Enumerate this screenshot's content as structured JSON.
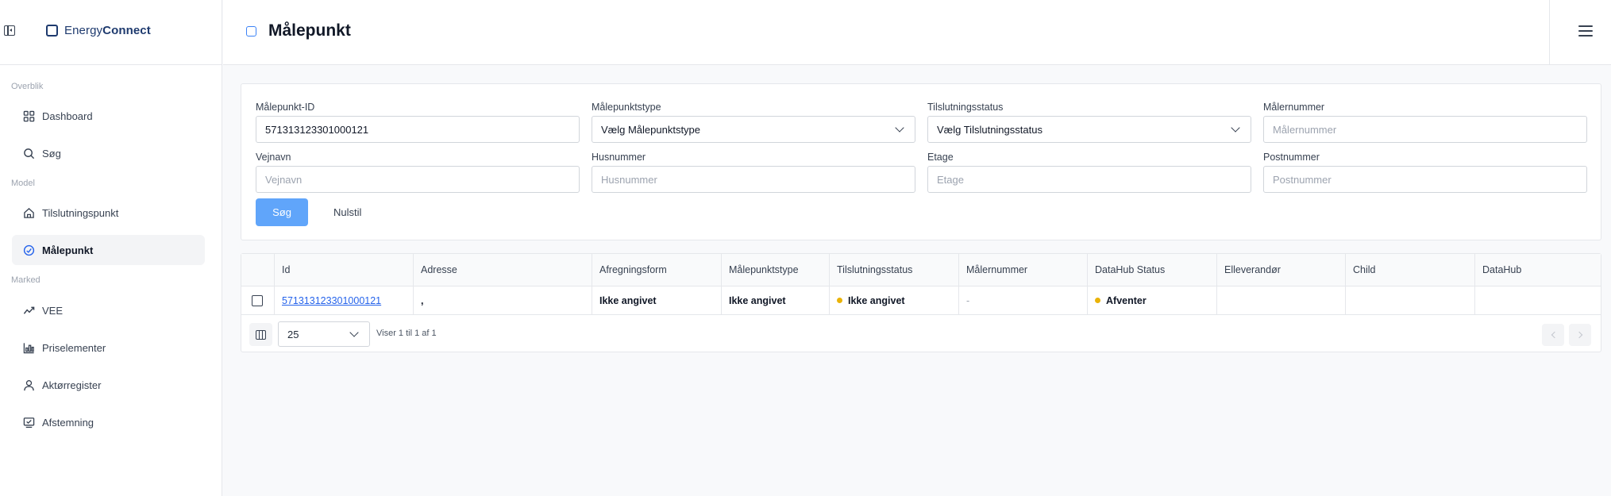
{
  "app": {
    "brand_regular": "Energy",
    "brand_bold": "Connect"
  },
  "sidebar": {
    "sections": [
      {
        "label": "Overblik"
      },
      {
        "label": "Model"
      },
      {
        "label": "Marked"
      }
    ],
    "items": [
      {
        "label": "Dashboard",
        "icon": "grid-icon"
      },
      {
        "label": "Søg",
        "icon": "search-icon"
      },
      {
        "label": "Tilslutningspunkt",
        "icon": "home-icon"
      },
      {
        "label": "Målepunkt",
        "icon": "gauge-icon",
        "active": true
      },
      {
        "label": "VEE",
        "icon": "activity-icon"
      },
      {
        "label": "Priselementer",
        "icon": "bar-chart-icon"
      },
      {
        "label": "Aktørregister",
        "icon": "user-icon"
      },
      {
        "label": "Afstemning",
        "icon": "check-screen-icon"
      }
    ]
  },
  "header": {
    "title": "Målepunkt"
  },
  "filters": {
    "malepunkt_id": {
      "label": "Målepunkt-ID",
      "value": "571313123301000121"
    },
    "malepunktstype": {
      "label": "Målepunktstype",
      "value": "Vælg Målepunktstype"
    },
    "tilslutningsstatus": {
      "label": "Tilslutningsstatus",
      "value": "Vælg Tilslutningsstatus"
    },
    "malernummer": {
      "label": "Målernummer",
      "placeholder": "Målernummer"
    },
    "vejnavn": {
      "label": "Vejnavn",
      "placeholder": "Vejnavn"
    },
    "husnummer": {
      "label": "Husnummer",
      "placeholder": "Husnummer"
    },
    "etage": {
      "label": "Etage",
      "placeholder": "Etage"
    },
    "postnummer": {
      "label": "Postnummer",
      "placeholder": "Postnummer"
    },
    "search_label": "Søg",
    "reset_label": "Nulstil"
  },
  "table": {
    "columns": [
      "Id",
      "Adresse",
      "Afregningsform",
      "Målepunktstype",
      "Tilslutningsstatus",
      "Målernummer",
      "DataHub Status",
      "Elleverandør",
      "Child",
      "DataHub"
    ],
    "rows": [
      {
        "id": "571313123301000121",
        "adresse": ",",
        "afregningsform": "Ikke angivet",
        "malepunktstype": "Ikke angivet",
        "tilslutningsstatus": "Ikke angivet",
        "malernummer": "-",
        "datahub_status": "Afventer",
        "elleverandor": "",
        "child": "",
        "datahub": ""
      }
    ],
    "page_size": "25",
    "pager_text": "Viser 1 til 1 af 1"
  },
  "colors": {
    "accent": "#2563eb",
    "button": "#60a5fa",
    "status_dot": "#eab308",
    "brand": "#1e3a6e"
  }
}
